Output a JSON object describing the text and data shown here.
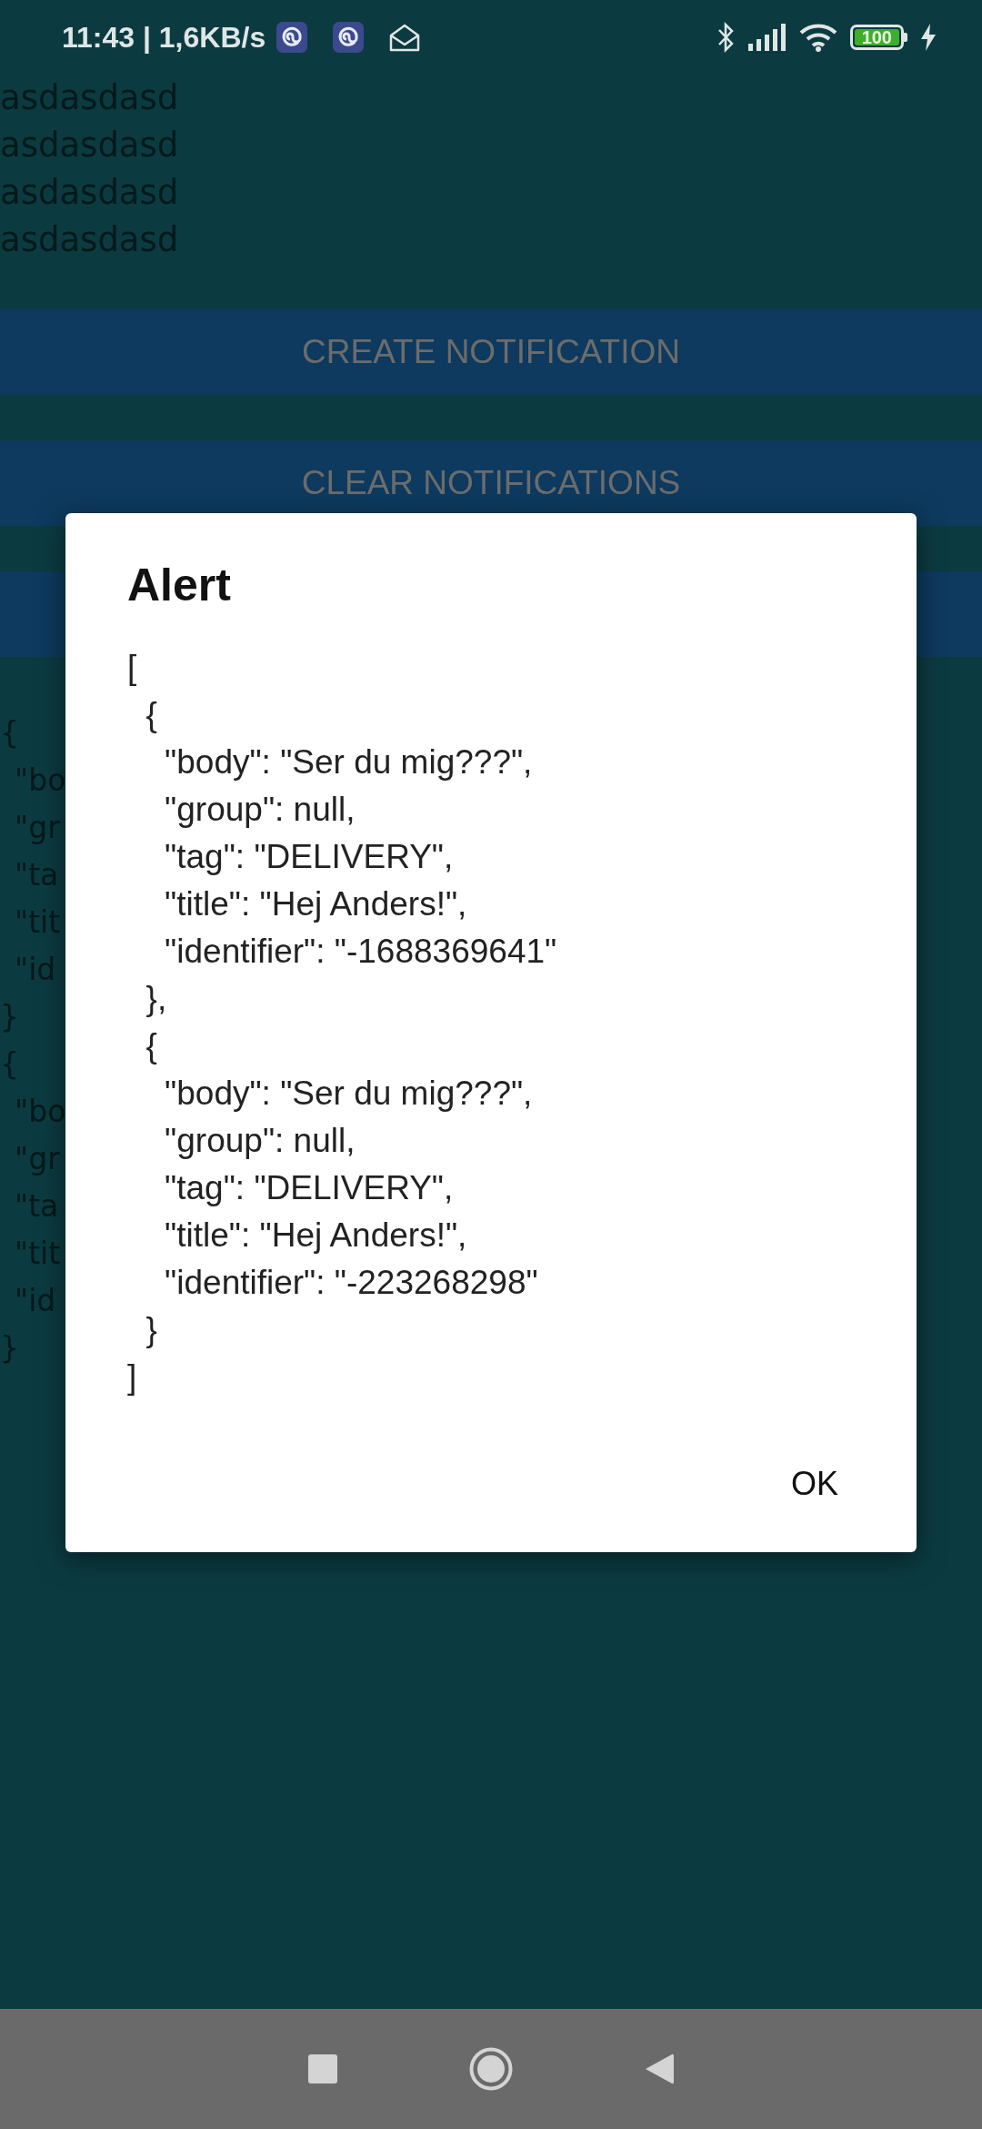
{
  "status_bar": {
    "time_speed": "11:43 | 1,6KB/s",
    "battery": "100",
    "charging": true
  },
  "app": {
    "lines": [
      "asdasdasd",
      "asdasdasd",
      "asdasdasd",
      "asdasdasd"
    ],
    "buttons": [
      {
        "label": "CREATE NOTIFICATION"
      },
      {
        "label": "CLEAR NOTIFICATIONS"
      },
      {
        "kind": "blank"
      }
    ],
    "output_lines": [
      "{",
      "\"bo",
      "\"gr",
      "\"ta",
      "\"tit",
      "\"id",
      "}",
      "{",
      "\"bo",
      "\"gr",
      "\"ta",
      "\"tit",
      "\"id",
      "}"
    ]
  },
  "dialog": {
    "title": "Alert",
    "message_lines": [
      "[",
      "  {",
      "    \"body\": \"Ser du mig???\",",
      "    \"group\": null,",
      "    \"tag\": \"DELIVERY\",",
      "    \"title\": \"Hej Anders!\",",
      "    \"identifier\": \"-1688369641\"",
      "  },",
      "  {",
      "    \"body\": \"Ser du mig???\",",
      "    \"group\": null,",
      "    \"tag\": \"DELIVERY\",",
      "    \"title\": \"Hej Anders!\",",
      "    \"identifier\": \"-223268298\"",
      "  }",
      "]"
    ],
    "buttons": [
      {
        "label": "OK"
      }
    ]
  }
}
